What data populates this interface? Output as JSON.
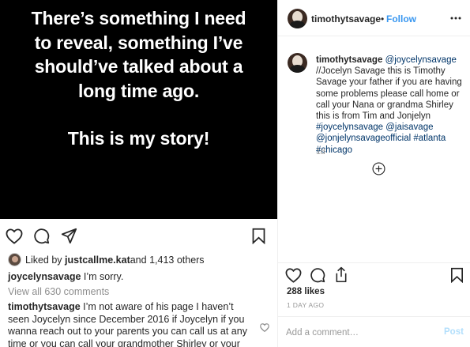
{
  "story": {
    "lines": [
      "There’s something I need",
      "to reveal, something I’ve",
      "should’ve talked about a",
      "long time ago.",
      "This is my story!"
    ]
  },
  "left": {
    "liked_by_prefix": "Liked by ",
    "liked_by_user": "justcallme.kat",
    "liked_by_suffix": " and 1,413 others",
    "caption_user": "joycelynsavage",
    "caption_text": " I’m sorry.",
    "view_all": "View all 630 comments",
    "comment_user": "timothytsavage",
    "comment_text": " I’m not aware of his page I haven’t seen Joycelyn since December 2016 if Joycelyn if you wanna reach out to your parents you can call us at any time or you can call your grandmother Shirley or your"
  },
  "header": {
    "username": "timothytsavage",
    "dot": "•",
    "follow_label": "Follow"
  },
  "post": {
    "username": "timothytsavage",
    "mention_user": "@joycelynsavage",
    "text_1": " //Jocelyn Savage this is Timothy Savage your father if you are having some problems please call home or call your Nana or grandma Shirley this is from Tim and Jonjelyn ",
    "hashtag_1": "#joycelynsavage",
    "mention_2": "@jaisavage",
    "mention_3": "@jonjelynsavageofficial",
    "hashtag_2": "#atlanta",
    "hashtag_3": "#chicago",
    "time": "1d"
  },
  "stats": {
    "likes": "288 likes",
    "date": "1 DAY AGO"
  },
  "comment_box": {
    "placeholder": "Add a comment…",
    "post_label": "Post"
  },
  "icons": {
    "heart": "heart-icon",
    "comment": "comment-icon",
    "share": "share-icon",
    "save": "bookmark-icon",
    "more": "more-icon",
    "load_more": "plus-circle-icon"
  },
  "colors": {
    "link": "#003569",
    "follow": "#3897f0",
    "post_disabled": "#b2dffc"
  }
}
